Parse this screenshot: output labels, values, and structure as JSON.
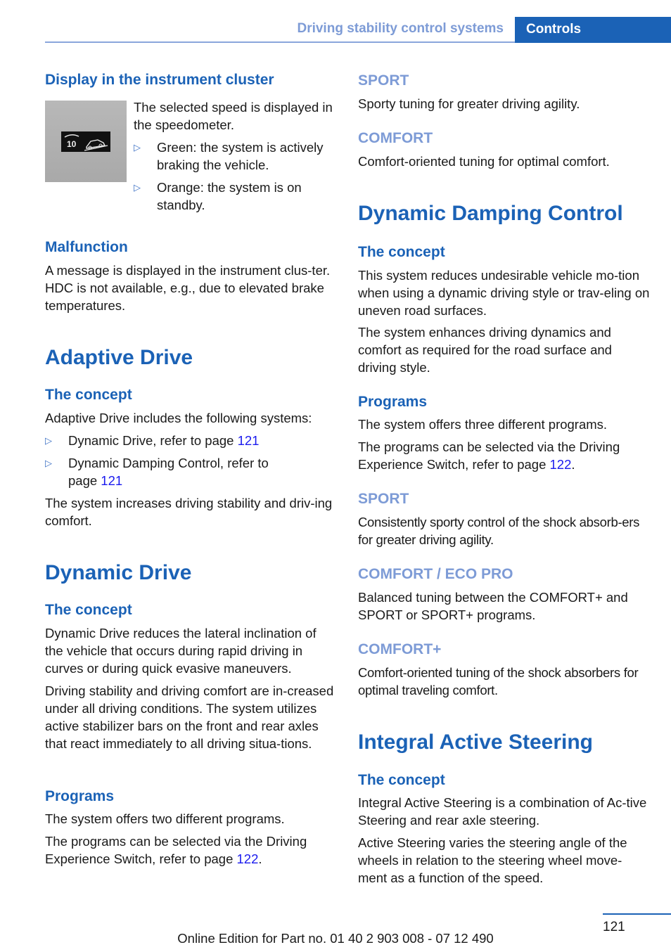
{
  "header": {
    "section": "Driving stability control systems",
    "chapter": "Controls"
  },
  "left": {
    "display": {
      "title": "Display in the instrument cluster",
      "image_alt": "HDC speed indicator icon",
      "image_number": "10",
      "text": "The selected speed is displayed in the speedometer.",
      "bullets": [
        "Green: the system is actively braking the vehicle.",
        "Orange: the system is on standby."
      ]
    },
    "malfunction": {
      "title": "Malfunction",
      "text": "A message is displayed in the instrument clus-ter. HDC is not available, e.g., due to elevated brake temperatures."
    },
    "adaptive_drive": {
      "title": "Adaptive Drive",
      "concept_title": "The concept",
      "intro": "Adaptive Drive includes the following systems:",
      "items": [
        {
          "text": "Dynamic Drive, refer to page ",
          "page": "121"
        },
        {
          "text": "Dynamic Damping Control, refer to page ",
          "page": "121"
        }
      ],
      "outro": "The system increases driving stability and driv-ing comfort."
    },
    "dynamic_drive": {
      "title": "Dynamic Drive",
      "concept_title": "The concept",
      "p1": "Dynamic Drive reduces the lateral inclination of the vehicle that occurs during rapid driving in curves or during quick evasive maneuvers.",
      "p2": "Driving stability and driving comfort are in-creased under all driving conditions. The system utilizes active stabilizer bars on the front and rear axles that react immediately to all driving situa-tions.",
      "programs_title": "Programs",
      "programs_p1": "The system offers two different programs.",
      "programs_p2": "The programs can be selected via the Driving Experience Switch, refer to page ",
      "programs_page": "122",
      "period": "."
    }
  },
  "right": {
    "dd_programs": [
      {
        "name": "SPORT",
        "text": "Sporty tuning for greater driving agility."
      },
      {
        "name": "COMFORT",
        "text": "Comfort-oriented tuning for optimal comfort."
      }
    ],
    "ddc": {
      "title": "Dynamic Damping Control",
      "concept_title": "The concept",
      "p1": "This system reduces undesirable vehicle mo-tion when using a dynamic driving style or trav-eling on uneven road surfaces.",
      "p2": "The system enhances driving dynamics and comfort as required for the road surface and driving style.",
      "programs_title": "Programs",
      "programs_p1": "The system offers three different programs.",
      "programs_p2": "The programs can be selected via the Driving Experience Switch, refer to page ",
      "programs_page": "122",
      "period": ".",
      "programs": [
        {
          "name": "SPORT",
          "text": "Consistently sporty control of the shock absorb-ers for greater driving agility."
        },
        {
          "name": "COMFORT / ECO PRO",
          "text": "Balanced tuning between the COMFORT+ and SPORT or SPORT+ programs."
        },
        {
          "name": "COMFORT+",
          "text": "Comfort-oriented tuning of the shock absorbers for optimal traveling comfort."
        }
      ]
    },
    "ias": {
      "title": "Integral Active Steering",
      "concept_title": "The concept",
      "p1": "Integral Active Steering is a combination of Ac-tive Steering and rear axle steering.",
      "p2": "Active Steering varies the steering angle of the wheels in relation to the steering wheel move-ment as a function of the speed."
    }
  },
  "footer": {
    "page_number": "121",
    "edition": "Online Edition for Part no. 01 40 2 903 008 - 07 12 490"
  },
  "colors": {
    "heading_blue": "#1b62b6",
    "subheading_light_blue": "#7d9bd6",
    "link_blue": "#1a1aee"
  }
}
